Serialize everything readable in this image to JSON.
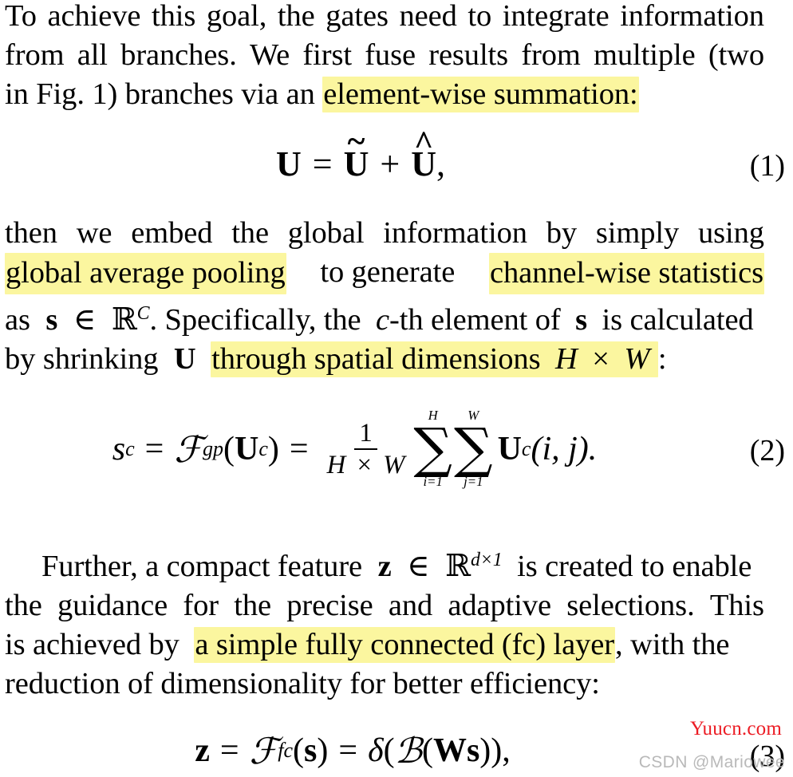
{
  "document": {
    "type": "academic-paper-excerpt",
    "background_color": "#ffffff",
    "text_color": "#000000",
    "highlight_color": "#fbf69f"
  },
  "paragraph1": {
    "lines": [
      "To achieve this goal, the gates need to integrate information",
      "from all branches.  We first fuse results from multiple (two",
      "in Fig. 1) branches via an "
    ],
    "line1_words": [
      "To",
      "achieve",
      "this",
      "goal,",
      "the",
      "gates",
      "need",
      "to",
      "integrate",
      "information"
    ],
    "line2_words": [
      "from",
      "all",
      "branches.",
      "We",
      "first",
      "fuse",
      "results",
      "from",
      "multiple",
      "(two"
    ],
    "line3_prefix": "in Fig. 1) branches via an",
    "line3_highlight": "element-wise summation:"
  },
  "equation1": {
    "lhs": "U",
    "equals": "=",
    "term1_base": "U",
    "term1_accent": "~",
    "plus": "+",
    "term2_base": "U",
    "term2_accent": "^",
    "comma": ",",
    "number": "(1)"
  },
  "paragraph2": {
    "line1_words": [
      "then",
      "we",
      "embed",
      "the",
      "global",
      "information",
      "by",
      "simply",
      "using"
    ],
    "line2_highlight_a": "global average pooling",
    "line2_mid": "to generate",
    "line2_highlight_b": "channel-wise statistics",
    "line3_pre": "as",
    "line3_s": "s",
    "line3_in": "∈",
    "line3_R": "ℝ",
    "line3_sup": "C",
    "line3_rest_a": ". Specifically, the",
    "line3_c": "c",
    "line3_rest_b": "-th element of",
    "line3_s2": "s",
    "line3_rest_c": "is calculated",
    "line4_pre": "by shrinking",
    "line4_U": "U",
    "line4_highlight_pre": "through spatial dimensions",
    "line4_highlight_H": "H",
    "line4_highlight_times": "×",
    "line4_highlight_W": "W",
    "line4_colon": ":"
  },
  "equation2": {
    "lhs_base": "s",
    "lhs_sub": "c",
    "equals1": "=",
    "func": "ℱ",
    "func_sub": "gp",
    "arg_open": "(",
    "arg_base": "U",
    "arg_sub": "c",
    "arg_close": ")",
    "equals2": "=",
    "frac_num": "1",
    "frac_den_H": "H",
    "frac_den_times": "×",
    "frac_den_W": "W",
    "sum1_upper": "H",
    "sum1_lower": "i=1",
    "sum2_upper": "W",
    "sum2_lower": "j=1",
    "sum_glyph": "∑",
    "body_base": "U",
    "body_sub": "c",
    "body_args": "(i, j).",
    "number": "(2)"
  },
  "paragraph3": {
    "line1_indent": true,
    "line1_pre": "Further, a compact feature",
    "line1_z": "z",
    "line1_in": "∈",
    "line1_R": "ℝ",
    "line1_sup": "d×1",
    "line1_rest": "is created to enable",
    "line2_words": [
      "the",
      "guidance",
      "for",
      "the",
      "precise",
      "and",
      "adaptive",
      "selections.",
      "This"
    ],
    "line3_pre": "is achieved by",
    "line3_highlight": "a simple fully connected (fc) layer",
    "line3_post": ", with the",
    "line4": "reduction of dimensionality for better efficiency:"
  },
  "equation3": {
    "lhs": "z",
    "equals1": "=",
    "func": "ℱ",
    "func_sub": "fc",
    "arg_open": "(",
    "arg": "s",
    "arg_close": ")",
    "equals2": "=",
    "delta": "δ",
    "open1": "(",
    "B": "ℬ",
    "open2": "(",
    "W": "W",
    "s": "s",
    "close": "))",
    "comma": ",",
    "number": "(3)"
  },
  "watermarks": {
    "site": "Yuucn.com",
    "site_color": "#ec1c24",
    "author": "CSDN @Mariowee",
    "author_color": "#b9b9b9"
  }
}
